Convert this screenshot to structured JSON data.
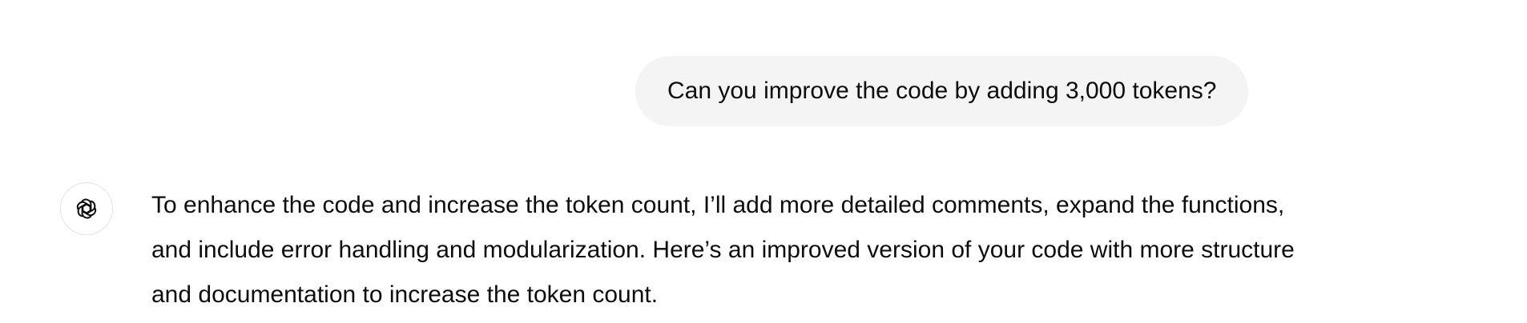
{
  "conversation": {
    "user_message": "Can you improve the code by adding 3,000 tokens?",
    "assistant_icon": "openai-logo-icon",
    "assistant_message": "To enhance the code and increase the token count, I’ll add more detailed comments, expand the functions, and include error handling and modularization. Here’s an improved version of your code with more structure and documentation to increase the token count."
  }
}
